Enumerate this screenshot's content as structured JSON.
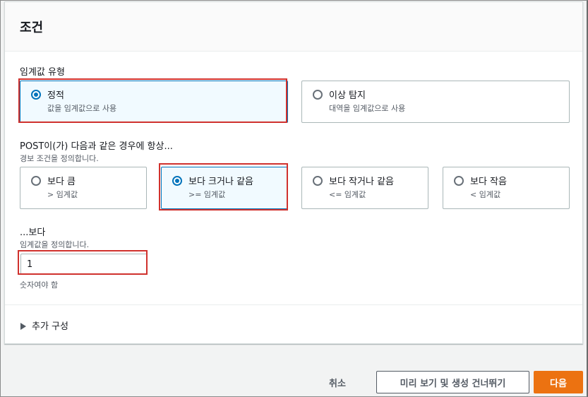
{
  "panel": {
    "title": "조건"
  },
  "threshold_type": {
    "label": "임계값 유형",
    "options": [
      {
        "title": "정적",
        "subtitle": "값을 임계값으로 사용",
        "selected": true
      },
      {
        "title": "이상 탐지",
        "subtitle": "대역을 임계값으로 사용",
        "selected": false
      }
    ]
  },
  "condition": {
    "label": "POST이(가) 다음과 같은 경우에 항상...",
    "description": "경보 조건을 정의합니다.",
    "options": [
      {
        "title": "보다 큼",
        "subtitle": "> 임계값",
        "selected": false
      },
      {
        "title": "보다 크거나 같음",
        "subtitle": ">= 임계값",
        "selected": true
      },
      {
        "title": "보다 작거나 같음",
        "subtitle": "<= 임계값",
        "selected": false
      },
      {
        "title": "보다 작음",
        "subtitle": "< 임계값",
        "selected": false
      }
    ]
  },
  "threshold_value": {
    "label": "...보다",
    "description": "임계값을 정의합니다.",
    "value": "1",
    "hint": "숫자여야 함"
  },
  "additional_config": {
    "label": "추가 구성"
  },
  "footer": {
    "cancel_label": "취소",
    "skip_label": "미리 보기 및 생성 건너뛰기",
    "next_label": "다음"
  },
  "colors": {
    "accent": "#0073bb",
    "primary_button": "#ec7211",
    "highlight": "#d0312d"
  }
}
